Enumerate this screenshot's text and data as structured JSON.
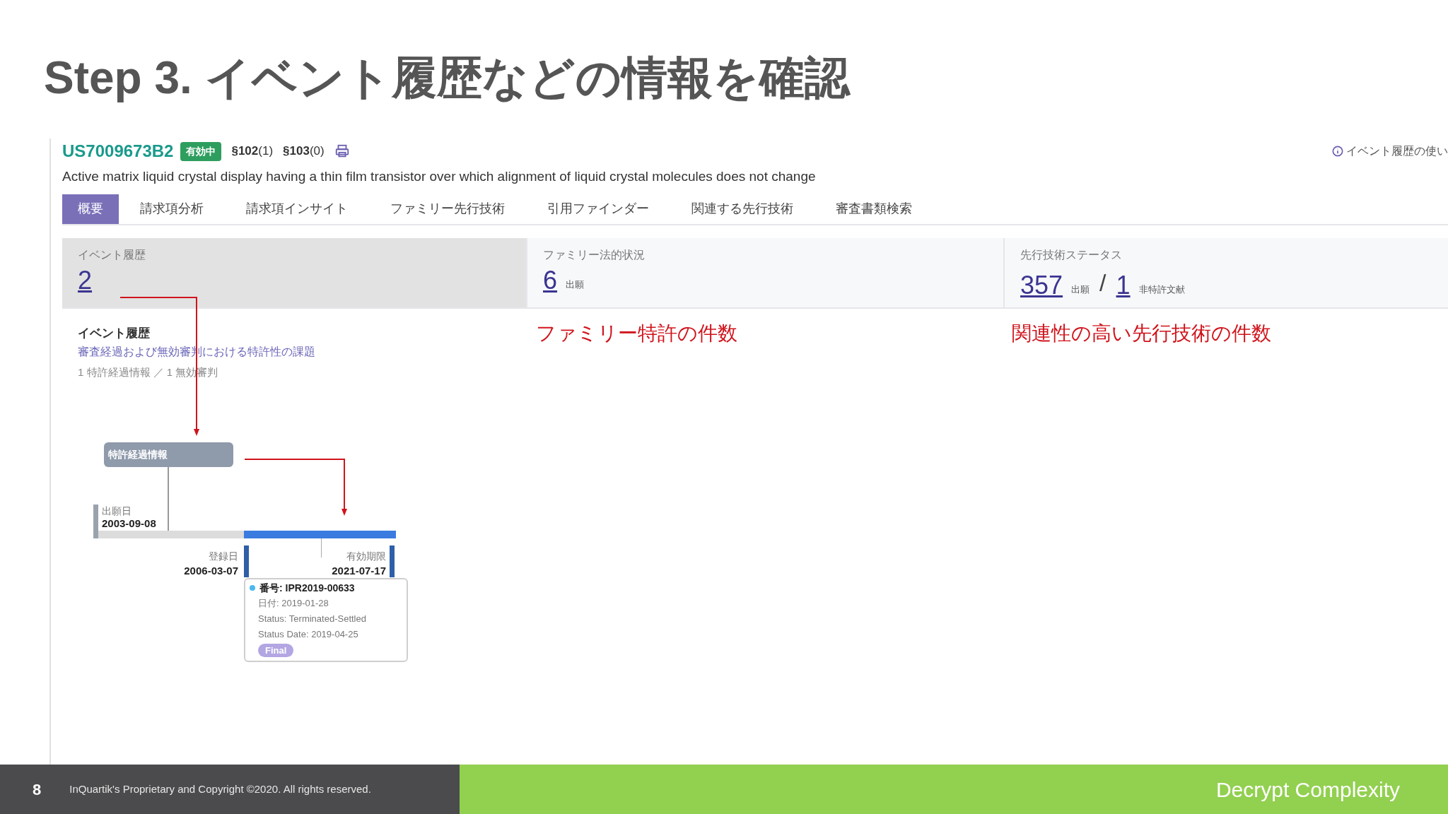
{
  "slide_title": "Step 3. イベント履歴などの情報を確認",
  "patent": {
    "number": "US7009673B2",
    "status_badge": "有効中",
    "sections": [
      "**§102**(1)",
      "**§103**(0)"
    ],
    "description": "Active matrix liquid crystal display having a thin film transistor over which alignment of liquid crystal molecules does not change"
  },
  "help_link": "イベント履歴の使い",
  "tabs": [
    {
      "label": "概要",
      "selected": true
    },
    {
      "label": "請求項分析",
      "selected": false
    },
    {
      "label": "請求項インサイト",
      "selected": false
    },
    {
      "label": "ファミリー先行技術",
      "selected": false
    },
    {
      "label": "引用ファインダー",
      "selected": false
    },
    {
      "label": "関連する先行技術",
      "selected": false
    },
    {
      "label": "審査書類検索",
      "selected": false
    }
  ],
  "stats": [
    {
      "label": "イベント履歴",
      "selected": true,
      "figures": [
        {
          "value": "2"
        }
      ]
    },
    {
      "label": "ファミリー法的状況",
      "selected": false,
      "figures": [
        {
          "value": "6",
          "unit": "出願"
        }
      ]
    },
    {
      "label": "先行技術ステータス",
      "selected": false,
      "separator": "/",
      "figures": [
        {
          "value": "357",
          "unit": "出願"
        },
        {
          "value": "1",
          "unit": "非特許文献"
        }
      ]
    }
  ],
  "annotations": [
    "ファミリー特許の件数",
    "関連性の高い先行技術の件数"
  ],
  "event_history": {
    "heading": "イベント履歴",
    "subtitle": "審査経過および無効審判における特許性の課題",
    "summary": "1 特許経過情報 ／ 1 無効審判"
  },
  "timeline": {
    "node_label": "特許経過情報",
    "filing": {
      "label": "出願日",
      "date": "2003-09-08"
    },
    "registration": {
      "label": "登録日",
      "date": "2006-03-07"
    },
    "expiry": {
      "label": "有効期限",
      "date": "2021-07-17"
    },
    "event": {
      "number": "番号: IPR2019-00633",
      "date": "日付: 2019-01-28",
      "status": "Status: Terminated-Settled",
      "status_date": "Status Date: 2019-04-25",
      "badge": "Final"
    }
  },
  "footer": {
    "page": "8",
    "copyright": "InQuartik's Proprietary and Copyright ©2020. All rights reserved.",
    "tagline": "Decrypt Complexity"
  }
}
